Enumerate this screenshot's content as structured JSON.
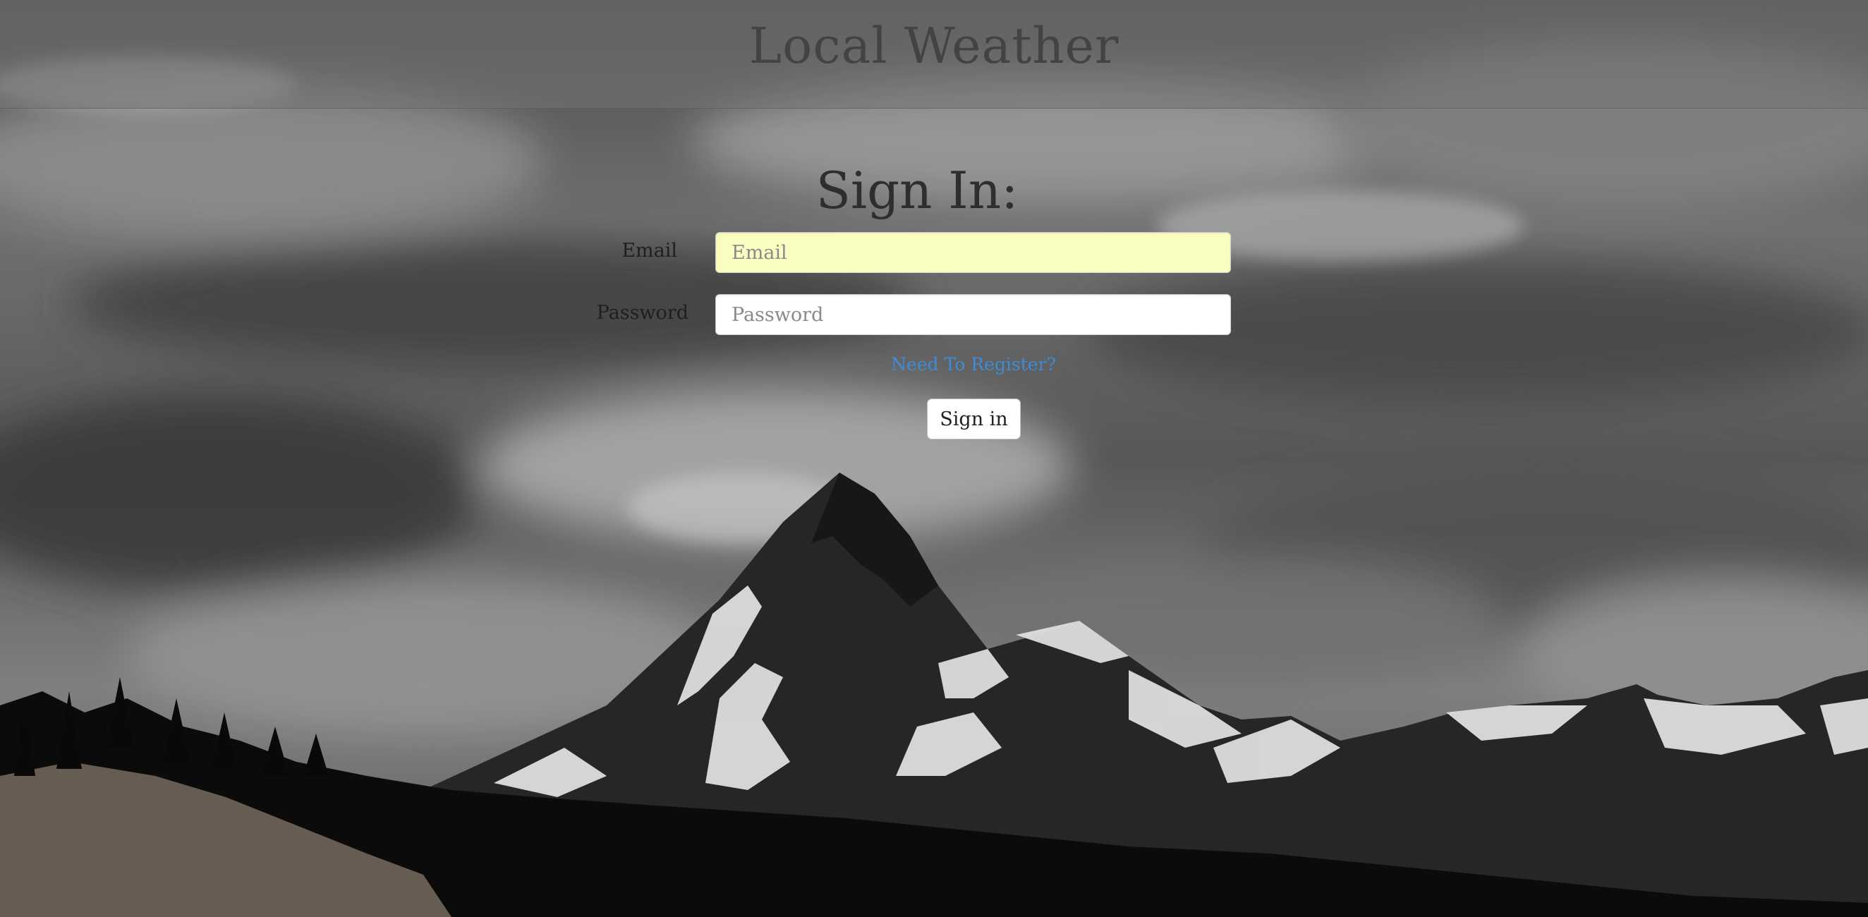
{
  "header": {
    "title": "Local Weather"
  },
  "signin": {
    "title": "Sign In:",
    "email": {
      "label": "Email",
      "placeholder": "Email",
      "value": ""
    },
    "password": {
      "label": "Password",
      "placeholder": "Password",
      "value": ""
    },
    "register_link": "Need To Register?",
    "submit_label": "Sign in"
  },
  "colors": {
    "email_field_bg": "#f9fdc0",
    "link": "#3d8dd6",
    "title_text": "#434343"
  }
}
